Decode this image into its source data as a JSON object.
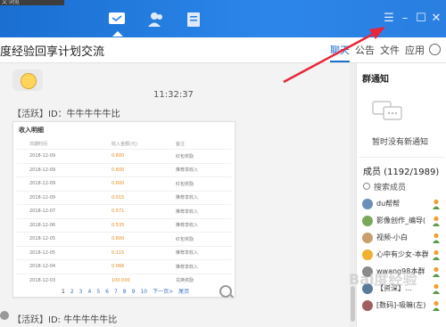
{
  "window": {
    "strip_text": "文·浏览",
    "tabs": [
      "chat",
      "contacts",
      "files"
    ],
    "controls": {
      "menu": "☰",
      "minimize": "–",
      "maximize": "☐",
      "close": "✕"
    }
  },
  "header": {
    "group_title": "度经验回享计划交流",
    "tabs": [
      {
        "label": "聊天",
        "active": true
      },
      {
        "label": "公告",
        "active": false
      },
      {
        "label": "文件",
        "active": false
      },
      {
        "label": "应用",
        "active": false
      }
    ]
  },
  "chat": {
    "time": "11:32:37",
    "messages": [
      {
        "role": "【活跃】",
        "id_label": "ID：牛牛牛牛牛比"
      },
      {
        "role": "【活跃】",
        "id_label": "ID: 牛牛牛牛牛比"
      }
    ],
    "card": {
      "title": "收入明细",
      "columns": [
        "日期时间",
        "收入金额(元)",
        "备注"
      ],
      "rows": [
        {
          "date": "2018-12-09",
          "amount": "0.600",
          "note": "红包奖励"
        },
        {
          "date": "2018-12-09",
          "amount": "0.600",
          "note": "推荐享收入"
        },
        {
          "date": "2018-12-09",
          "amount": "0.600",
          "note": "红包奖励"
        },
        {
          "date": "2018-12-09",
          "amount": "0.015",
          "note": "推荐享收入"
        },
        {
          "date": "2018-12-07",
          "amount": "0.571",
          "note": "推荐享收入"
        },
        {
          "date": "2018-12-06",
          "amount": "0.535",
          "note": "推荐享收入"
        },
        {
          "date": "2018-12-05",
          "amount": "0.600",
          "note": "红包奖励"
        },
        {
          "date": "2018-12-05",
          "amount": "0.115",
          "note": "推荐享收入"
        },
        {
          "date": "2018-12-04",
          "amount": "0.066",
          "note": "推荐享收入"
        },
        {
          "date": "2018-12-03",
          "amount": "100.000",
          "note": "兑换奖励"
        }
      ],
      "pager": [
        "1",
        "2",
        "3",
        "4",
        "5",
        "6",
        "7",
        "8",
        "9",
        "10",
        "下一页>",
        "尾页"
      ]
    }
  },
  "sidebar": {
    "notice_title": "群通知",
    "no_notice": "暂时没有新通知",
    "members_label": "成员 (1192/1989)",
    "search_placeholder": "搜索成员",
    "members": [
      {
        "name": "du帮帮",
        "color": "#6a8fb8"
      },
      {
        "name": "影像创作_编导(",
        "color": "#7aa85a"
      },
      {
        "name": "视频-小白",
        "color": "#c8a070"
      },
      {
        "name": "心中有少女-本群",
        "color": "#f0b030"
      },
      {
        "name": "wwang98本群",
        "color": "#8a8a8a"
      },
      {
        "name": "【资深】…",
        "color": "#5a7a9a"
      },
      {
        "name": "[数码]-吸嘛(左)",
        "color": "#a06060"
      }
    ]
  },
  "colors": {
    "brand": "#1a6fd1",
    "amount": "#e88c1f",
    "arrow": "#e8253a"
  },
  "watermark": "Bai度经验"
}
